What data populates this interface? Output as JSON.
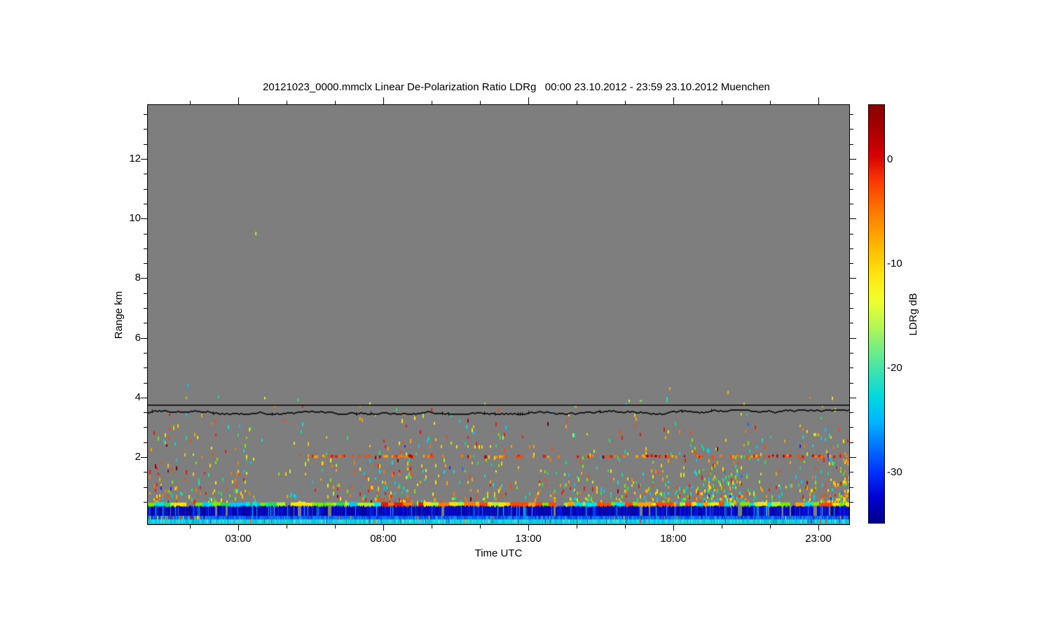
{
  "figure": {
    "background": "#ffffff",
    "title": "20121023_0000.mmclx Linear De-Polarization Ratio LDRg   00:00 23.10.2012 - 23:59 23.10.2012 Muenchen"
  },
  "chart_data": {
    "type": "heatmap",
    "title": "20121023_0000.mmclx Linear De-Polarization Ratio LDRg   00:00 23.10.2012 - 23:59 23.10.2012 Muenchen",
    "station": "Muenchen",
    "date": "23.10.2012",
    "time_span": "00:00 - 23:59",
    "xlabel": "Time UTC",
    "ylabel": "Range km",
    "colorbar_label": "LDRg dB",
    "grid": false,
    "xlim": [
      -0.12,
      24.06
    ],
    "ylim": [
      -0.254,
      13.81
    ],
    "x_major_ticks": [
      {
        "value": 3,
        "label": "03:00"
      },
      {
        "value": 8,
        "label": "08:00"
      },
      {
        "value": 13,
        "label": "13:00"
      },
      {
        "value": 18,
        "label": "18:00"
      },
      {
        "value": 23,
        "label": "23:00"
      }
    ],
    "x_minor_ticks": [
      1.333,
      4.667,
      6.333,
      9.667,
      11.333,
      14.667,
      16.333,
      19.667,
      21.333
    ],
    "y_major_ticks": [
      {
        "value": 2,
        "label": "2"
      },
      {
        "value": 4,
        "label": "4"
      },
      {
        "value": 6,
        "label": "6"
      },
      {
        "value": 8,
        "label": "8"
      },
      {
        "value": 10,
        "label": "10"
      },
      {
        "value": 12,
        "label": "12"
      }
    ],
    "y_minor_ticks": [
      0.5,
      1,
      1.5,
      2.5,
      3,
      3.5,
      4.5,
      5,
      5.5,
      6.5,
      7,
      7.5,
      8.5,
      9,
      9.5,
      10.5,
      11,
      11.5,
      12.5,
      13,
      13.5
    ],
    "colorbar": {
      "min_db": -34.8,
      "max_db": 5.2,
      "ticks": [
        {
          "value": 0,
          "label": "0"
        },
        {
          "value": -10,
          "label": "-10"
        },
        {
          "value": -20,
          "label": "-20"
        },
        {
          "value": -30,
          "label": "-30"
        }
      ],
      "stops": [
        {
          "p": 0.0,
          "c": "#860000"
        },
        {
          "p": 0.06,
          "c": "#a80000"
        },
        {
          "p": 0.12,
          "c": "#d40000"
        },
        {
          "p": 0.18,
          "c": "#f83800"
        },
        {
          "p": 0.26,
          "c": "#ff7c00"
        },
        {
          "p": 0.34,
          "c": "#ffb900"
        },
        {
          "p": 0.41,
          "c": "#ffe810"
        },
        {
          "p": 0.47,
          "c": "#eeff30"
        },
        {
          "p": 0.53,
          "c": "#b4f655"
        },
        {
          "p": 0.58,
          "c": "#7aee80"
        },
        {
          "p": 0.64,
          "c": "#3ae2b2"
        },
        {
          "p": 0.7,
          "c": "#00d8e0"
        },
        {
          "p": 0.76,
          "c": "#00b4ff"
        },
        {
          "p": 0.82,
          "c": "#0070ff"
        },
        {
          "p": 0.88,
          "c": "#0030ff"
        },
        {
          "p": 0.94,
          "c": "#0000d0"
        },
        {
          "p": 1.0,
          "c": "#000088"
        }
      ]
    },
    "no_data_color": "#7e7e7e",
    "marker_line_km": 3.765,
    "cloud_top_wavy_line_km": 3.53,
    "outlier_pixels": [
      {
        "hour": 3.58,
        "km": 9.51,
        "color": "#aef228"
      },
      {
        "hour": 5.03,
        "km": 3.93,
        "color": "#38e060"
      },
      {
        "hour": 7.25,
        "km": 3.25,
        "color": "#ffa000"
      },
      {
        "hour": 19.86,
        "km": 4.18,
        "color": "#ffb400"
      }
    ],
    "render": {
      "seed": 20121023,
      "speckle_zone": {
        "km_min": 0.52,
        "km_max": 3.45,
        "base_density": 0.16,
        "falloff_km": 0.75,
        "floor": 0.012
      },
      "red_row": {
        "km": 2.07,
        "hour_start": 4.95,
        "density": 0.38,
        "palette": [
          "#e81800",
          "#ff4800",
          "#ff7800",
          "#b40000",
          "#ffa000"
        ]
      },
      "faint_row": {
        "km": 2.42,
        "hour_start": 7.5,
        "hour_end": 13.5,
        "density": 0.08
      },
      "upper_sparse": {
        "km_min": 3.45,
        "km_max": 4.02,
        "density": 0.01
      },
      "above_line_sparse": {
        "km_min": 4.05,
        "km_max": 4.55,
        "density": 0.0012
      },
      "evening_patch": {
        "hour_center": 19.6,
        "hour_width": 1.5,
        "km_max": 3.0,
        "amp": 0.3
      },
      "right_edge_boost": {
        "hour_start": 23.2,
        "amp": 0.5
      },
      "warm_palette": [
        "#ffe400",
        "#ffc800",
        "#ffa000",
        "#ff7800",
        "#ff4800",
        "#e81c00"
      ],
      "cool_palette": [
        "#aef228",
        "#7ce800",
        "#00e0a0",
        "#00e4e4",
        "#00c8ff",
        "#28e060"
      ],
      "rare_palette": [
        "#a00000",
        "#700000",
        "#2864ff",
        "#2020ff"
      ],
      "streak_row": {
        "km_top": 0.5,
        "km_bottom": 0.36,
        "gap_prob": 0.06,
        "zones": [
          {
            "h_max": 7.8,
            "palette": [
              "#aef228",
              "#00e4e4",
              "#7ce800",
              "#ffe400",
              "#28d860",
              "#00c8ff"
            ]
          },
          {
            "h_max": 12.6,
            "palette": [
              "#ff7800",
              "#ff4800",
              "#ffc800",
              "#ffe400",
              "#e81800",
              "#aef228"
            ]
          },
          {
            "h_max": 24.2,
            "palette": [
              "#ffe400",
              "#aef228",
              "#00e4e4",
              "#ffa000",
              "#7ce800",
              "#ff4800"
            ]
          }
        ]
      },
      "blue_band": {
        "km_top": 0.36,
        "km_bottom": 0.03,
        "gap_prob": 0.022,
        "navy_palette": [
          "#0000a0",
          "#0000b4",
          "#0000c8",
          "#0210dc",
          "#000890",
          "#0020e6"
        ],
        "cyan_palette": [
          "#00a0ff",
          "#00c8ff",
          "#0060ff"
        ],
        "cyan_prob": 0.07
      },
      "mid_row": {
        "km_top": 0.03,
        "km_bottom": -0.09,
        "palette": [
          "#0048ff",
          "#0064ff",
          "#0082ff",
          "#00a0ff",
          "#0030e0"
        ],
        "warm_prob_early": 0.22,
        "warm_prob": 0.015,
        "early_hour_end": 1.9
      },
      "bottom_row": {
        "km_top": -0.09,
        "km_bottom": -0.22,
        "palette": [
          "#00c8f0",
          "#22d8ee",
          "#00b4e0",
          "#55e2ea",
          "#00dcc8"
        ],
        "warm_prob": 0.02,
        "dark_prob": 0.03
      }
    }
  }
}
